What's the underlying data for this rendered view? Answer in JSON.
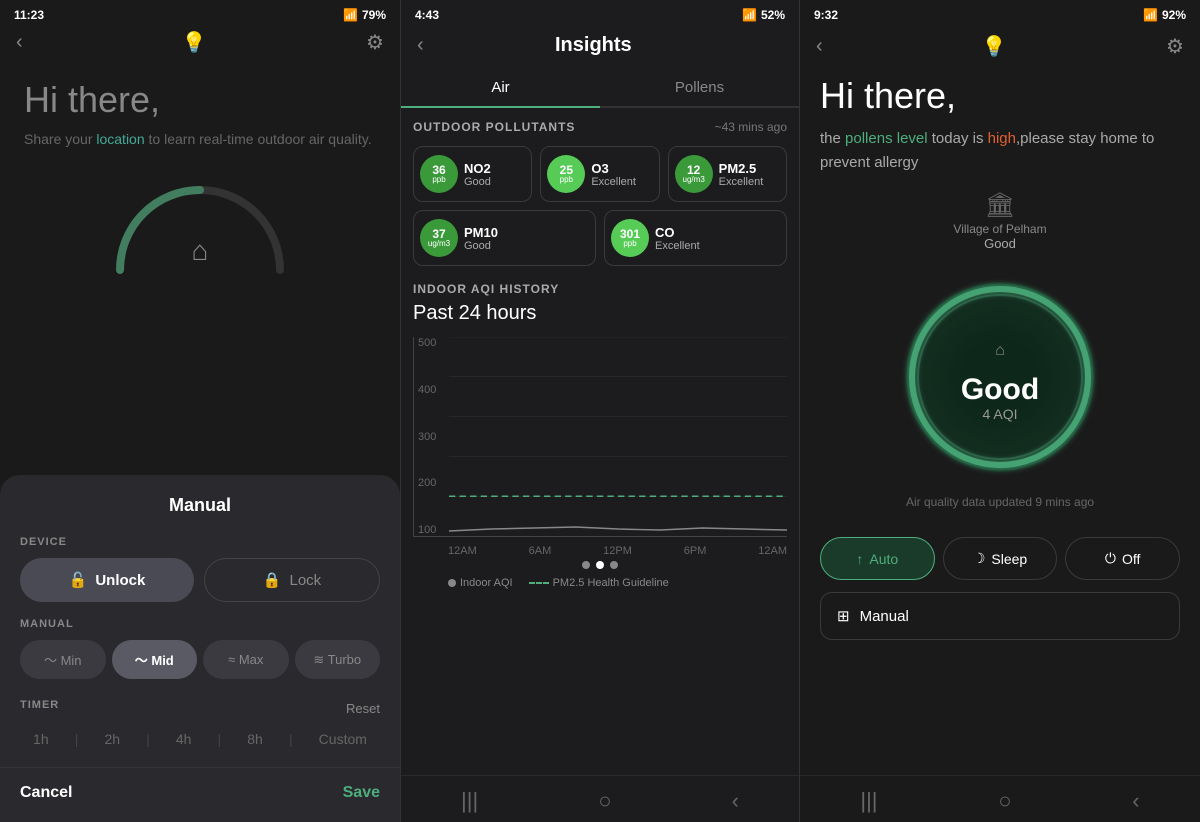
{
  "panel1": {
    "statusbar": {
      "time": "11:23",
      "icons": "📷 ○ 🔊 •",
      "battery": "79%"
    },
    "greeting": "Hi there,",
    "subtitle_pre": "Share your ",
    "subtitle_link": "location",
    "subtitle_post": " to learn real-time outdoor air quality.",
    "drawer": {
      "title": "Manual",
      "device_label": "DEVICE",
      "unlock_label": "Unlock",
      "lock_label": "Lock",
      "manual_label": "MANUAL",
      "speeds": [
        "Min",
        "Mid",
        "Max",
        "Turbo"
      ],
      "active_speed": "Mid",
      "timer_label": "TIMER",
      "timer_reset": "Reset",
      "timer_options": [
        "1h",
        "2h",
        "4h",
        "8h",
        "Custom"
      ],
      "cancel_label": "Cancel",
      "save_label": "Save"
    }
  },
  "panel2": {
    "statusbar": {
      "time": "4:43",
      "battery": "52%"
    },
    "title": "Insights",
    "tabs": [
      "Air",
      "Pollens"
    ],
    "active_tab": "Air",
    "outdoor_label": "OUTDOOR POLLUTANTS",
    "outdoor_time": "~43 mins ago",
    "pollutants": [
      {
        "value": "36",
        "unit": "ppb",
        "name": "NO2",
        "status": "Good",
        "bright": false
      },
      {
        "value": "25",
        "unit": "ppb",
        "name": "O3",
        "status": "Excellent",
        "bright": true
      },
      {
        "value": "12",
        "unit": "ug/m3",
        "name": "PM2.5",
        "status": "Excellent",
        "bright": false
      }
    ],
    "pollutants2": [
      {
        "value": "37",
        "unit": "ug/m3",
        "name": "PM10",
        "status": "Good",
        "bright": false
      },
      {
        "value": "301",
        "unit": "ppb",
        "name": "CO",
        "status": "Excellent",
        "bright": true
      }
    ],
    "indoor_label": "INDOOR AQI HISTORY",
    "past24_label": "Past 24 hours",
    "chart_y": [
      "500",
      "400",
      "300",
      "200",
      "100"
    ],
    "chart_x": [
      "12AM",
      "6AM",
      "12PM",
      "6PM",
      "12AM"
    ],
    "legend_indoor": "Indoor AQI",
    "legend_pm25": "PM2.5 Health Guideline"
  },
  "panel3": {
    "statusbar": {
      "time": "9:32",
      "battery": "92%"
    },
    "greeting": "Hi there,",
    "pollen_pre": "the ",
    "pollen_level_text": "pollens level",
    "pollen_mid": " today is ",
    "pollen_high": "high",
    "pollen_post": ",please stay home to prevent allergy",
    "location_icon": "🏛",
    "location_name": "Village of Pelham",
    "location_status": "Good",
    "aqi_label": "Good",
    "aqi_value": "4 AQI",
    "home_icon": "⌂",
    "air_quality_update": "Air quality data updated 9 mins ago",
    "modes": [
      "Auto",
      "Sleep",
      "Off"
    ],
    "active_mode": "Auto",
    "manual_label": "Manual",
    "mode_icons": [
      "↑",
      "☽",
      "⏻"
    ]
  }
}
